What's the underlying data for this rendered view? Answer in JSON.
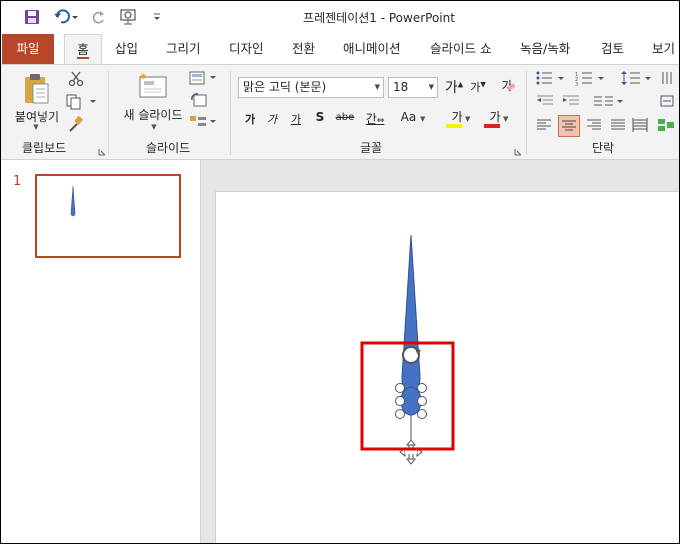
{
  "title_bar": {
    "document_title": "프레젠테이션1  -  PowerPoint",
    "qat": [
      "save-icon",
      "undo-icon",
      "redo-icon",
      "present-from-start-icon",
      "customize-qat-icon"
    ]
  },
  "tabs": [
    {
      "label": "파일"
    },
    {
      "label": "홈"
    },
    {
      "label": "삽입"
    },
    {
      "label": "그리기"
    },
    {
      "label": "디자인"
    },
    {
      "label": "전환"
    },
    {
      "label": "애니메이션"
    },
    {
      "label": "슬라이드 쇼"
    },
    {
      "label": "녹음/녹화"
    },
    {
      "label": "검토"
    },
    {
      "label": "보기"
    }
  ],
  "ribbon": {
    "clipboard": {
      "paste_label": "붙여넣기",
      "group_label": "클립보드"
    },
    "slides": {
      "new_slide_label": "새 슬라이드",
      "group_label": "슬라이드"
    },
    "font": {
      "font_name": "맑은 고딕 (본문)",
      "font_size": "18",
      "grow": "가",
      "shrink": "가",
      "bold": "가",
      "italic": "가",
      "underline": "가",
      "strike": "S",
      "abc": "abe",
      "spacing": "간",
      "case": "Aa",
      "highlight": "가",
      "color": "가",
      "clear": "가",
      "group_label": "글꼴"
    },
    "paragraph": {
      "group_label": "단락"
    }
  },
  "slides_panel": {
    "slide_number": "1"
  },
  "colors": {
    "accent": "#b7472a",
    "shape_fill": "#4472c4",
    "shape_stroke": "#2f528f",
    "selection_box": "#e00000"
  }
}
